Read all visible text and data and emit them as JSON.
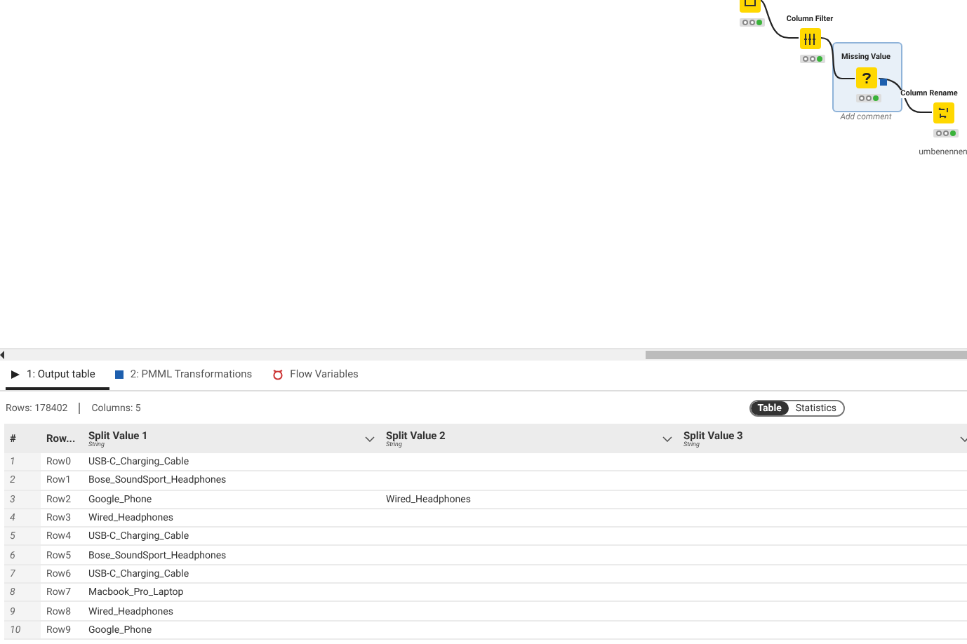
{
  "workflow": {
    "nodes": [
      {
        "selected": false
      },
      {
        "label": "Column Filter",
        "selected": false
      },
      {
        "label": "Missing Value",
        "comment": "Add comment",
        "selected": true
      },
      {
        "label": "Column Rename",
        "comment": "umbenennen",
        "selected": false
      }
    ]
  },
  "tabs": [
    {
      "label": "1: Output table",
      "selected": true
    },
    {
      "label": "2: PMML Transformations",
      "selected": false
    },
    {
      "label": "Flow Variables",
      "selected": false
    }
  ],
  "summary": {
    "rows": "Rows: 178402",
    "columns": "Columns: 5"
  },
  "view_toggle": [
    {
      "label": "Table",
      "selected": true
    },
    {
      "label": "Statistics",
      "selected": false
    }
  ],
  "table": {
    "index_header": "#",
    "rowid_header": "Row...",
    "columns": [
      {
        "name": "Split Value 1",
        "type": "String"
      },
      {
        "name": "Split Value 2",
        "type": "String"
      },
      {
        "name": "Split Value 3",
        "type": "String"
      }
    ],
    "rows": [
      {
        "index": "1",
        "rowid": "Row0",
        "cells": [
          "USB-C_Charging_Cable",
          "",
          ""
        ]
      },
      {
        "index": "2",
        "rowid": "Row1",
        "cells": [
          "Bose_SoundSport_Headphones",
          "",
          ""
        ]
      },
      {
        "index": "3",
        "rowid": "Row2",
        "cells": [
          "Google_Phone",
          "Wired_Headphones",
          ""
        ]
      },
      {
        "index": "4",
        "rowid": "Row3",
        "cells": [
          "Wired_Headphones",
          "",
          ""
        ]
      },
      {
        "index": "5",
        "rowid": "Row4",
        "cells": [
          "USB-C_Charging_Cable",
          "",
          ""
        ]
      },
      {
        "index": "6",
        "rowid": "Row5",
        "cells": [
          "Bose_SoundSport_Headphones",
          "",
          ""
        ]
      },
      {
        "index": "7",
        "rowid": "Row6",
        "cells": [
          "USB-C_Charging_Cable",
          "",
          ""
        ]
      },
      {
        "index": "8",
        "rowid": "Row7",
        "cells": [
          "Macbook_Pro_Laptop",
          "",
          ""
        ]
      },
      {
        "index": "9",
        "rowid": "Row8",
        "cells": [
          "Wired_Headphones",
          "",
          ""
        ]
      },
      {
        "index": "10",
        "rowid": "Row9",
        "cells": [
          "Google_Phone",
          "",
          ""
        ]
      }
    ]
  }
}
